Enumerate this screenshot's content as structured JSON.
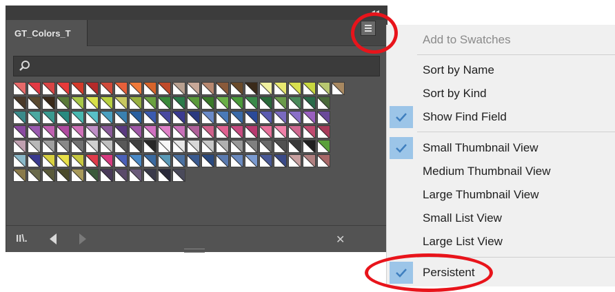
{
  "panel": {
    "tab_label": "GT_Colors_T",
    "collapse_glyph": "◂◂",
    "search_placeholder": "",
    "icons": {
      "search": "search-icon",
      "menu": "hamburger-menu-icon",
      "library": "swatch-libraries-icon",
      "prev": "previous-icon",
      "next": "next-icon",
      "tools": "tools-icon"
    },
    "library_glyph": "II\\.",
    "tools_glyph": "✕",
    "swatch_rows": [
      [
        "#e86a6a",
        "#e23a44",
        "#d94545",
        "#e83a3a",
        "#d43a2a",
        "#b52a2a",
        "#d04a3a",
        "#e8603a",
        "#f07a3a",
        "#d8642a",
        "#c04a2a",
        "#b8a090",
        "#c8a898",
        "#b88870",
        "#8a5a3a",
        "#6a4a2a",
        "#3a2a1a",
        "#f0f0a0",
        "#e8e870",
        "#d8e050",
        "#c8d840",
        "#b8c870",
        "#a88860"
      ],
      [
        "#4a3a2a",
        "#5a4a30",
        "#3a2a1a",
        "#5a7a3a",
        "#a8c848",
        "#d8e048",
        "#b8d040",
        "#c8c860",
        "#98b040",
        "#6aa040",
        "#3a8a3a",
        "#2a7a4a",
        "#5a9a3a",
        "#3a7a2a",
        "#6ab048",
        "#4a9a3a",
        "#3a8a4a",
        "#2a6a3a",
        "#6a9a4a",
        "#4a8a5a",
        "#2a6a4a",
        "#4a6a3a"
      ],
      [
        "#3a8a8a",
        "#4aa8a0",
        "#3a9a90",
        "#2a8a80",
        "#48b8b0",
        "#58c0c8",
        "#4aa0c0",
        "#3a80b0",
        "#2a60a0",
        "#3a5ab0",
        "#4a4aa0",
        "#3a3a90",
        "#2a3a80",
        "#6a8ac8",
        "#4a7ab8",
        "#3a6aa8",
        "#2a4a98",
        "#5a5ab0",
        "#7a6ac0",
        "#8a70c8",
        "#9a60c0",
        "#6a4a9a"
      ],
      [
        "#8a4aa0",
        "#9a5ab0",
        "#c060b0",
        "#b04aa0",
        "#d070b8",
        "#c090c8",
        "#8a5a9a",
        "#5a3a80",
        "#a058a8",
        "#d070c0",
        "#e080c8",
        "#c870b8",
        "#b0609a",
        "#d0608a",
        "#e06090",
        "#c84a80",
        "#b83a70",
        "#e8709a",
        "#f080a8",
        "#d06890",
        "#c04a70",
        "#a83a5a"
      ],
      [
        "#c0a0b0",
        "#b8b8b8",
        "#a0a0a0",
        "#888888",
        "#707070",
        "#d0d0d0",
        "#c0c0c0",
        "#585858",
        "#404040",
        "#282828",
        "#f8f8f8",
        "#e8e8e8",
        "#d8d8d8",
        "#c8c8c8",
        "#b0b0b0",
        "#989898",
        "#808080",
        "#686868",
        "#505050",
        "#383838",
        "#202020",
        "#5aa03a"
      ],
      [
        "#8ab8c8",
        "#3a3a90",
        "#d8d040",
        "#e8e048",
        "#c8c840",
        "#e03a4a",
        "#d83a80",
        "#4a60b8",
        "#4a8ac8",
        "#3a6aa0",
        "#5a9ab8",
        "#4a70a0",
        "#3a5a90",
        "#2a4a80",
        "#5a7ab0",
        "#6a8ac0",
        "#7a9ad0",
        "#4a5a98",
        "#3a4a88",
        "#c8a0a0",
        "#b08080",
        "#a86868"
      ],
      [
        "#8a7a4a",
        "#6a6a4a",
        "#5a5a3a",
        "#4a4a2a",
        "#a89a5a",
        "#3a5a3a",
        "#4a3a5a",
        "#5a4a6a",
        "#6a5a7a",
        "#3a3a4a",
        "#2a2a3a",
        "#4a4a5a"
      ]
    ]
  },
  "menu": {
    "items": [
      {
        "label": "Add to Swatches",
        "checked": false,
        "disabled": true
      },
      {
        "label": "Sort by Name",
        "checked": false,
        "disabled": false
      },
      {
        "label": "Sort by Kind",
        "checked": false,
        "disabled": false
      },
      {
        "label": "Show Find Field",
        "checked": true,
        "disabled": false
      },
      {
        "label": "Small Thumbnail View",
        "checked": true,
        "disabled": false
      },
      {
        "label": "Medium Thumbnail View",
        "checked": false,
        "disabled": false
      },
      {
        "label": "Large Thumbnail View",
        "checked": false,
        "disabled": false
      },
      {
        "label": "Small List View",
        "checked": false,
        "disabled": false
      },
      {
        "label": "Large List View",
        "checked": false,
        "disabled": false
      },
      {
        "label": "Persistent",
        "checked": true,
        "disabled": false
      }
    ],
    "check_icon": "checkmark-icon"
  },
  "colors": {
    "annotation": "#e8141b",
    "check_highlight": "#9cc5e8",
    "panel_bg": "#535353"
  }
}
